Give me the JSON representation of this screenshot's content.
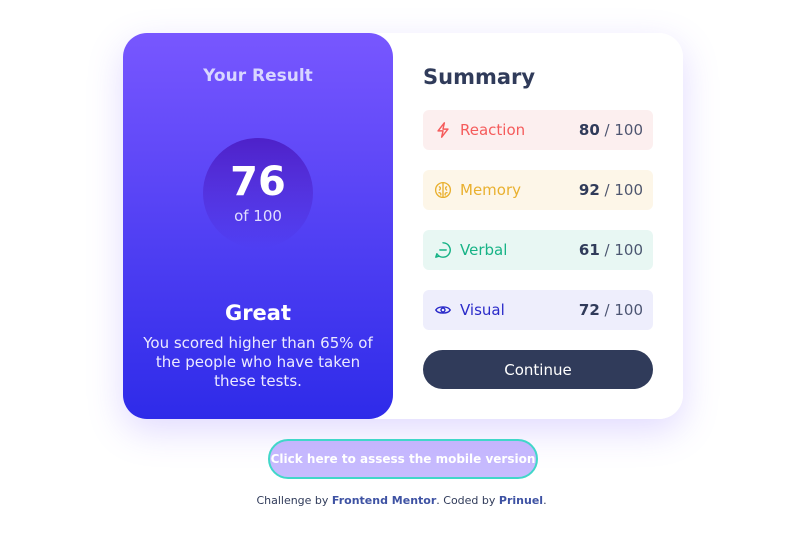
{
  "result": {
    "title": "Your Result",
    "score": "76",
    "score_of": "of 100",
    "grade": "Great",
    "description": "You scored higher than 65% of the people who have taken these tests."
  },
  "summary": {
    "title": "Summary",
    "max_label": "/ 100",
    "items": [
      {
        "label": "Reaction",
        "value": "80",
        "icon": "lightning-icon",
        "color": "#f55b5b",
        "bg": "#fcefef"
      },
      {
        "label": "Memory",
        "value": "92",
        "icon": "brain-icon",
        "color": "#e9b02f",
        "bg": "#fdf6e8"
      },
      {
        "label": "Verbal",
        "value": "61",
        "icon": "chat-bubble-icon",
        "color": "#17b386",
        "bg": "#e8f7f3"
      },
      {
        "label": "Visual",
        "value": "72",
        "icon": "eye-icon",
        "color": "#2a2ac9",
        "bg": "#eeeefc"
      }
    ],
    "continue_label": "Continue"
  },
  "mobile_button": {
    "label": "Click here to assess the mobile version"
  },
  "attribution": {
    "prefix": "Challenge by",
    "frontend_mentor": "Frontend Mentor",
    "middle": ". Coded by",
    "author": "Prinuel",
    "suffix": "."
  },
  "colors": {
    "gradient_start": "#7857ff",
    "gradient_end": "#2e2be9",
    "dark_navy": "#303b5a",
    "accent_teal": "#41d7c9"
  }
}
